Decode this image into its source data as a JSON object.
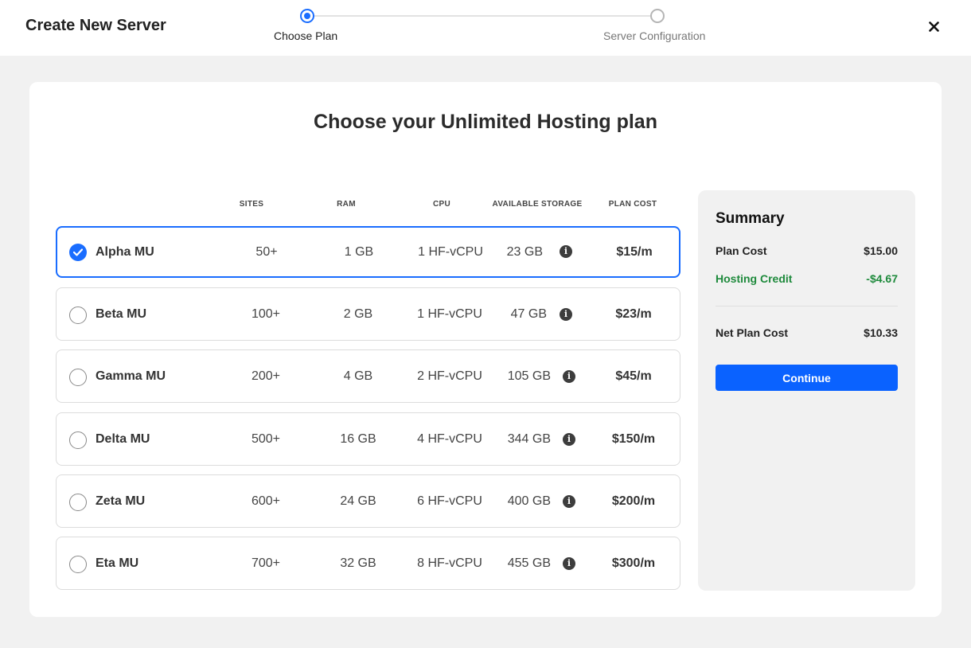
{
  "header": {
    "title": "Create New Server",
    "steps": [
      {
        "label": "Choose Plan",
        "state": "active"
      },
      {
        "label": "Server Configuration",
        "state": "inactive"
      }
    ],
    "close_icon": "close-icon"
  },
  "main": {
    "title": "Choose your Unlimited Hosting plan",
    "columns": [
      "SITES",
      "RAM",
      "CPU",
      "AVAILABLE STORAGE",
      "PLAN COST"
    ],
    "plans": [
      {
        "name": "Alpha MU",
        "sites": "50+",
        "ram": "1 GB",
        "cpu": "1 HF-vCPU",
        "storage": "23 GB",
        "cost": "$15/m",
        "selected": true
      },
      {
        "name": "Beta MU",
        "sites": "100+",
        "ram": "2 GB",
        "cpu": "1 HF-vCPU",
        "storage": "47 GB",
        "cost": "$23/m",
        "selected": false
      },
      {
        "name": "Gamma MU",
        "sites": "200+",
        "ram": "4 GB",
        "cpu": "2 HF-vCPU",
        "storage": "105 GB",
        "cost": "$45/m",
        "selected": false
      },
      {
        "name": "Delta MU",
        "sites": "500+",
        "ram": "16 GB",
        "cpu": "4 HF-vCPU",
        "storage": "344 GB",
        "cost": "$150/m",
        "selected": false
      },
      {
        "name": "Zeta MU",
        "sites": "600+",
        "ram": "24 GB",
        "cpu": "6 HF-vCPU",
        "storage": "400 GB",
        "cost": "$200/m",
        "selected": false
      },
      {
        "name": "Eta MU",
        "sites": "700+",
        "ram": "32 GB",
        "cpu": "8 HF-vCPU",
        "storage": "455 GB",
        "cost": "$300/m",
        "selected": false
      }
    ],
    "info_glyph": "i"
  },
  "summary": {
    "title": "Summary",
    "plan_cost_label": "Plan Cost",
    "plan_cost_value": "$15.00",
    "credit_label": "Hosting Credit",
    "credit_value": "-$4.67",
    "net_label": "Net Plan Cost",
    "net_value": "$10.33",
    "continue_label": "Continue"
  },
  "colors": {
    "accent": "#1a6dff",
    "button": "#0a62ff",
    "credit": "#1e8a3c"
  }
}
